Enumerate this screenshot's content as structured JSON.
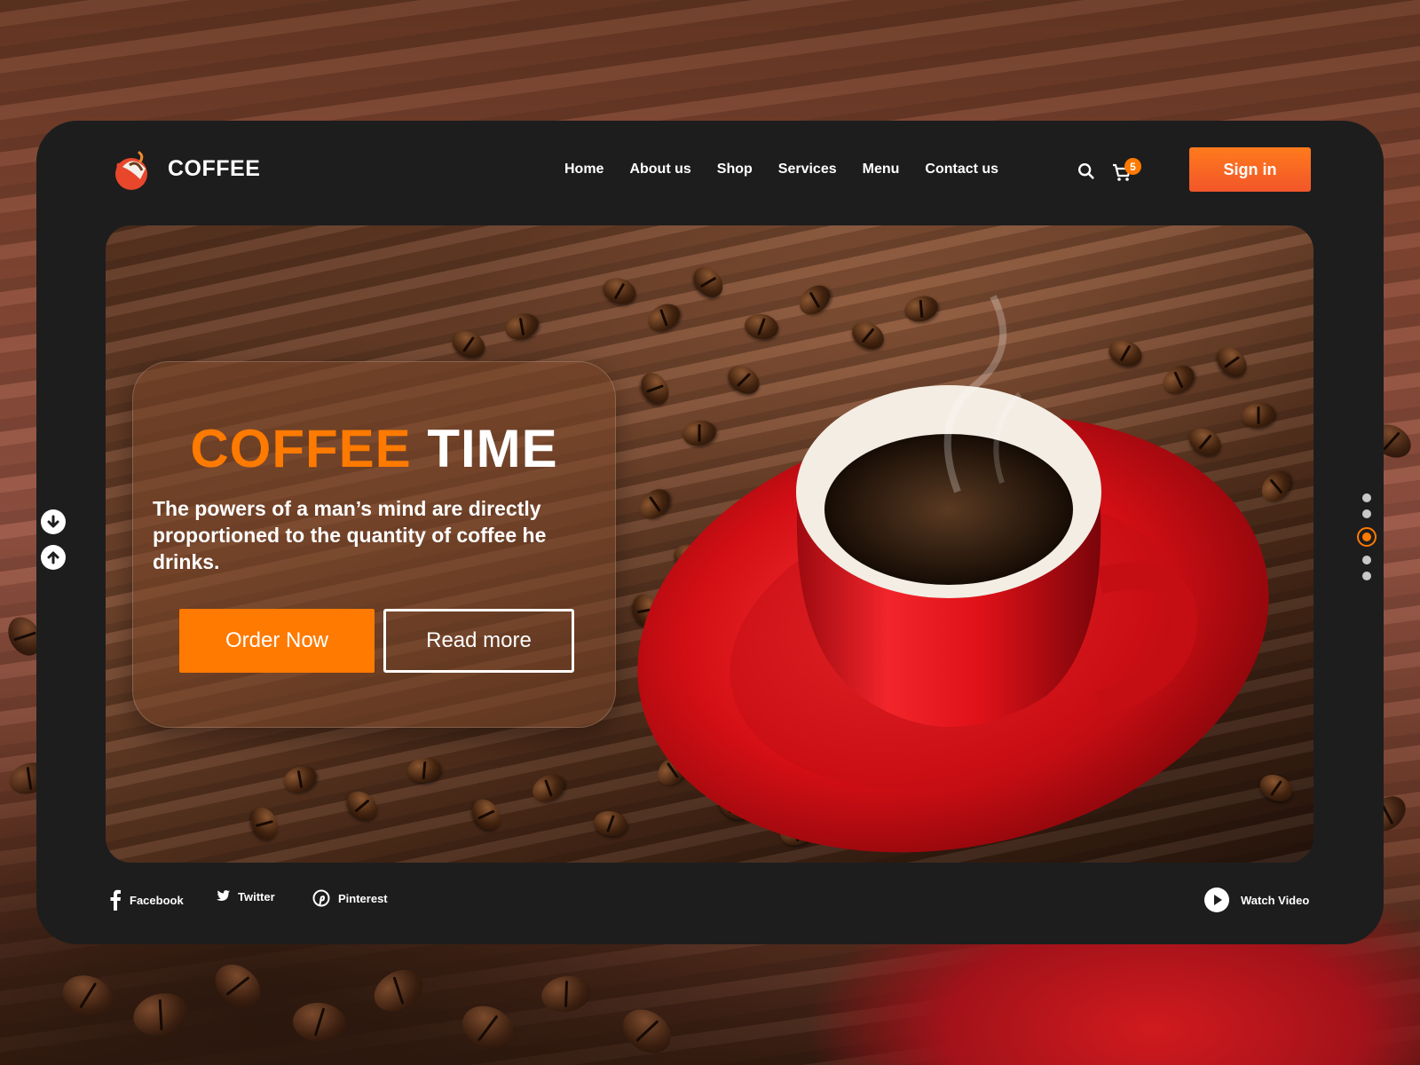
{
  "brand": {
    "name": "COFFEE"
  },
  "nav": {
    "items": [
      {
        "label": "Home"
      },
      {
        "label": "About us"
      },
      {
        "label": "Shop"
      },
      {
        "label": "Services"
      },
      {
        "label": "Menu"
      },
      {
        "label": "Contact us"
      }
    ]
  },
  "header": {
    "cart_count": "5",
    "signin_label": "Sign in",
    "icons": [
      "search-icon",
      "cart-icon"
    ]
  },
  "hero": {
    "title_accent": "COFFEE",
    "title_plain": "TIME",
    "quote": "The powers of a man’s mind are directly proportioned to the quantity of coffee he drinks.",
    "order_label": "Order Now",
    "read_label": "Read more"
  },
  "slider": {
    "total": 5,
    "active_index": 2
  },
  "footer": {
    "socials": [
      {
        "label": "Facebook",
        "icon": "facebook-icon"
      },
      {
        "label": "Twitter",
        "icon": "twitter-icon"
      },
      {
        "label": "Pinterest",
        "icon": "pinterest-icon"
      }
    ],
    "watch_label": "Watch Video"
  },
  "colors": {
    "accent": "#ff7a00",
    "card": "#1d1d1e",
    "signin": "#f2562a"
  }
}
